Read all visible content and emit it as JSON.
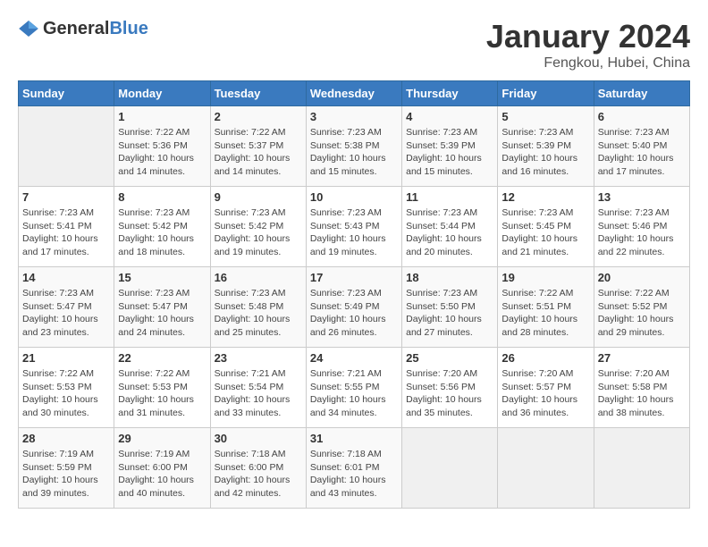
{
  "header": {
    "logo_general": "General",
    "logo_blue": "Blue",
    "month_title": "January 2024",
    "subtitle": "Fengkou, Hubei, China"
  },
  "weekdays": [
    "Sunday",
    "Monday",
    "Tuesday",
    "Wednesday",
    "Thursday",
    "Friday",
    "Saturday"
  ],
  "weeks": [
    [
      {
        "day": "",
        "sunrise": "",
        "sunset": "",
        "daylight": ""
      },
      {
        "day": "1",
        "sunrise": "Sunrise: 7:22 AM",
        "sunset": "Sunset: 5:36 PM",
        "daylight": "Daylight: 10 hours and 14 minutes."
      },
      {
        "day": "2",
        "sunrise": "Sunrise: 7:22 AM",
        "sunset": "Sunset: 5:37 PM",
        "daylight": "Daylight: 10 hours and 14 minutes."
      },
      {
        "day": "3",
        "sunrise": "Sunrise: 7:23 AM",
        "sunset": "Sunset: 5:38 PM",
        "daylight": "Daylight: 10 hours and 15 minutes."
      },
      {
        "day": "4",
        "sunrise": "Sunrise: 7:23 AM",
        "sunset": "Sunset: 5:39 PM",
        "daylight": "Daylight: 10 hours and 15 minutes."
      },
      {
        "day": "5",
        "sunrise": "Sunrise: 7:23 AM",
        "sunset": "Sunset: 5:39 PM",
        "daylight": "Daylight: 10 hours and 16 minutes."
      },
      {
        "day": "6",
        "sunrise": "Sunrise: 7:23 AM",
        "sunset": "Sunset: 5:40 PM",
        "daylight": "Daylight: 10 hours and 17 minutes."
      }
    ],
    [
      {
        "day": "7",
        "sunrise": "Sunrise: 7:23 AM",
        "sunset": "Sunset: 5:41 PM",
        "daylight": "Daylight: 10 hours and 17 minutes."
      },
      {
        "day": "8",
        "sunrise": "Sunrise: 7:23 AM",
        "sunset": "Sunset: 5:42 PM",
        "daylight": "Daylight: 10 hours and 18 minutes."
      },
      {
        "day": "9",
        "sunrise": "Sunrise: 7:23 AM",
        "sunset": "Sunset: 5:42 PM",
        "daylight": "Daylight: 10 hours and 19 minutes."
      },
      {
        "day": "10",
        "sunrise": "Sunrise: 7:23 AM",
        "sunset": "Sunset: 5:43 PM",
        "daylight": "Daylight: 10 hours and 19 minutes."
      },
      {
        "day": "11",
        "sunrise": "Sunrise: 7:23 AM",
        "sunset": "Sunset: 5:44 PM",
        "daylight": "Daylight: 10 hours and 20 minutes."
      },
      {
        "day": "12",
        "sunrise": "Sunrise: 7:23 AM",
        "sunset": "Sunset: 5:45 PM",
        "daylight": "Daylight: 10 hours and 21 minutes."
      },
      {
        "day": "13",
        "sunrise": "Sunrise: 7:23 AM",
        "sunset": "Sunset: 5:46 PM",
        "daylight": "Daylight: 10 hours and 22 minutes."
      }
    ],
    [
      {
        "day": "14",
        "sunrise": "Sunrise: 7:23 AM",
        "sunset": "Sunset: 5:47 PM",
        "daylight": "Daylight: 10 hours and 23 minutes."
      },
      {
        "day": "15",
        "sunrise": "Sunrise: 7:23 AM",
        "sunset": "Sunset: 5:47 PM",
        "daylight": "Daylight: 10 hours and 24 minutes."
      },
      {
        "day": "16",
        "sunrise": "Sunrise: 7:23 AM",
        "sunset": "Sunset: 5:48 PM",
        "daylight": "Daylight: 10 hours and 25 minutes."
      },
      {
        "day": "17",
        "sunrise": "Sunrise: 7:23 AM",
        "sunset": "Sunset: 5:49 PM",
        "daylight": "Daylight: 10 hours and 26 minutes."
      },
      {
        "day": "18",
        "sunrise": "Sunrise: 7:23 AM",
        "sunset": "Sunset: 5:50 PM",
        "daylight": "Daylight: 10 hours and 27 minutes."
      },
      {
        "day": "19",
        "sunrise": "Sunrise: 7:22 AM",
        "sunset": "Sunset: 5:51 PM",
        "daylight": "Daylight: 10 hours and 28 minutes."
      },
      {
        "day": "20",
        "sunrise": "Sunrise: 7:22 AM",
        "sunset": "Sunset: 5:52 PM",
        "daylight": "Daylight: 10 hours and 29 minutes."
      }
    ],
    [
      {
        "day": "21",
        "sunrise": "Sunrise: 7:22 AM",
        "sunset": "Sunset: 5:53 PM",
        "daylight": "Daylight: 10 hours and 30 minutes."
      },
      {
        "day": "22",
        "sunrise": "Sunrise: 7:22 AM",
        "sunset": "Sunset: 5:53 PM",
        "daylight": "Daylight: 10 hours and 31 minutes."
      },
      {
        "day": "23",
        "sunrise": "Sunrise: 7:21 AM",
        "sunset": "Sunset: 5:54 PM",
        "daylight": "Daylight: 10 hours and 33 minutes."
      },
      {
        "day": "24",
        "sunrise": "Sunrise: 7:21 AM",
        "sunset": "Sunset: 5:55 PM",
        "daylight": "Daylight: 10 hours and 34 minutes."
      },
      {
        "day": "25",
        "sunrise": "Sunrise: 7:20 AM",
        "sunset": "Sunset: 5:56 PM",
        "daylight": "Daylight: 10 hours and 35 minutes."
      },
      {
        "day": "26",
        "sunrise": "Sunrise: 7:20 AM",
        "sunset": "Sunset: 5:57 PM",
        "daylight": "Daylight: 10 hours and 36 minutes."
      },
      {
        "day": "27",
        "sunrise": "Sunrise: 7:20 AM",
        "sunset": "Sunset: 5:58 PM",
        "daylight": "Daylight: 10 hours and 38 minutes."
      }
    ],
    [
      {
        "day": "28",
        "sunrise": "Sunrise: 7:19 AM",
        "sunset": "Sunset: 5:59 PM",
        "daylight": "Daylight: 10 hours and 39 minutes."
      },
      {
        "day": "29",
        "sunrise": "Sunrise: 7:19 AM",
        "sunset": "Sunset: 6:00 PM",
        "daylight": "Daylight: 10 hours and 40 minutes."
      },
      {
        "day": "30",
        "sunrise": "Sunrise: 7:18 AM",
        "sunset": "Sunset: 6:00 PM",
        "daylight": "Daylight: 10 hours and 42 minutes."
      },
      {
        "day": "31",
        "sunrise": "Sunrise: 7:18 AM",
        "sunset": "Sunset: 6:01 PM",
        "daylight": "Daylight: 10 hours and 43 minutes."
      },
      {
        "day": "",
        "sunrise": "",
        "sunset": "",
        "daylight": ""
      },
      {
        "day": "",
        "sunrise": "",
        "sunset": "",
        "daylight": ""
      },
      {
        "day": "",
        "sunrise": "",
        "sunset": "",
        "daylight": ""
      }
    ]
  ]
}
